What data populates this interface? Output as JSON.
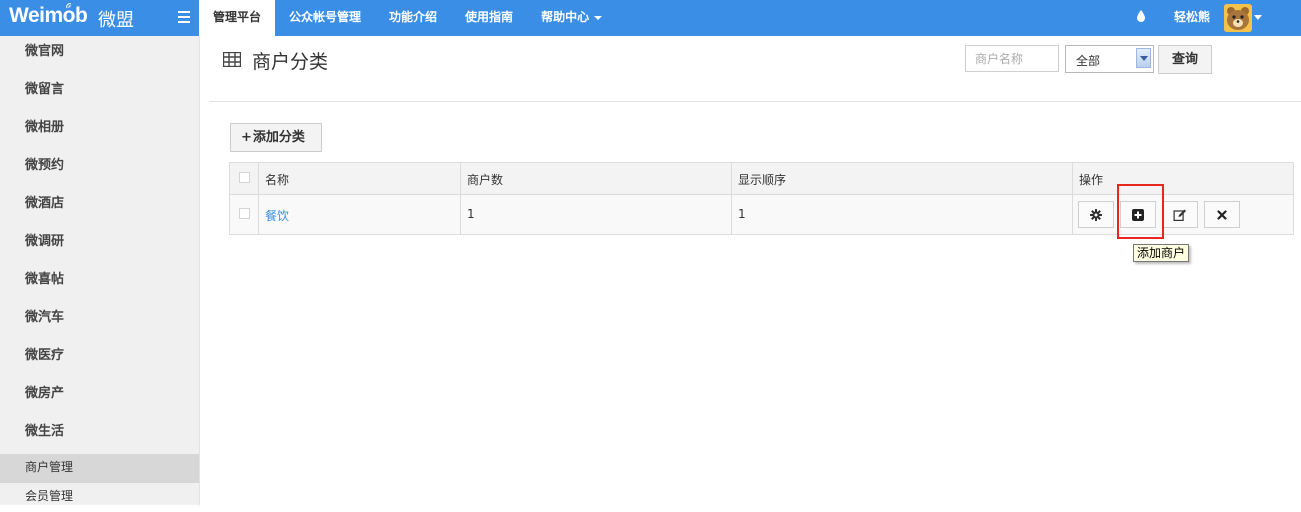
{
  "brand": {
    "logo": "Weimob",
    "logo_cn": "微盟"
  },
  "nav": {
    "items": [
      "管理平台",
      "公众帐号管理",
      "功能介绍",
      "使用指南",
      "帮助中心"
    ],
    "active_index": 0
  },
  "user": {
    "name": "轻松熊"
  },
  "sidebar": {
    "items": [
      "微官网",
      "微留言",
      "微相册",
      "微预约",
      "微酒店",
      "微调研",
      "微喜帖",
      "微汽车",
      "微医疗",
      "微房产",
      "微生活"
    ],
    "sub_items": [
      "商户管理",
      "会员管理"
    ],
    "active_sub_index": 0
  },
  "page": {
    "title": "商户分类"
  },
  "search": {
    "placeholder": "商户名称",
    "select_value": "全部",
    "query_label": "查询"
  },
  "toolbar": {
    "add_label": "添加分类"
  },
  "table": {
    "headers": {
      "name": "名称",
      "count": "商户数",
      "order": "显示顺序",
      "actions": "操作"
    },
    "rows": [
      {
        "name": "餐饮",
        "count": "1",
        "order": "1"
      }
    ]
  },
  "tooltip": {
    "text": "添加商户"
  },
  "colors": {
    "accent": "#3a8ee6",
    "highlight": "#e8251f"
  }
}
